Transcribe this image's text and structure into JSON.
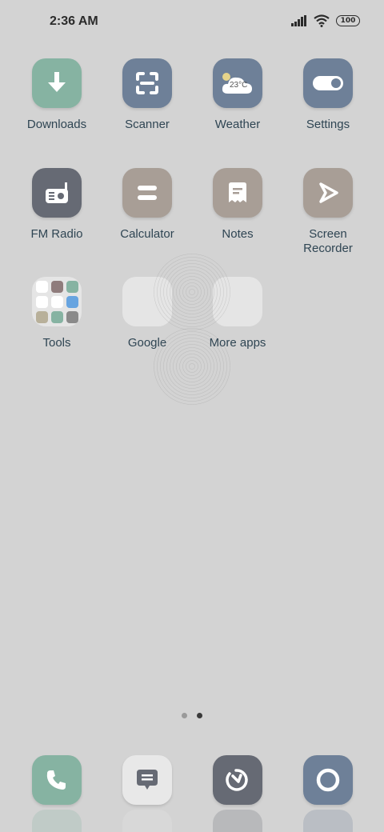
{
  "status_bar": {
    "time": "2:36 AM",
    "battery": "100",
    "icons": [
      "signal-icon",
      "wifi-icon",
      "battery-icon"
    ]
  },
  "apps": [
    {
      "label": "Downloads",
      "icon": "download-icon",
      "color": "#86b3a2"
    },
    {
      "label": "Scanner",
      "icon": "scanner-icon",
      "color": "#6e8098"
    },
    {
      "label": "Weather",
      "icon": "weather-icon",
      "color": "#6e8098",
      "icon_text": "23°C"
    },
    {
      "label": "Settings",
      "icon": "toggle-icon",
      "color": "#6e8098"
    },
    {
      "label": "FM Radio",
      "icon": "radio-icon",
      "color": "#666a74"
    },
    {
      "label": "Calculator",
      "icon": "calculator-icon",
      "color": "#a89e96"
    },
    {
      "label": "Notes",
      "icon": "notes-icon",
      "color": "#a89e96"
    },
    {
      "label": "Screen Recorder",
      "icon": "screen-recorder-icon",
      "color": "#a89e96"
    }
  ],
  "folders": [
    {
      "label": "Tools",
      "mini_icons": [
        "#6e8098",
        "#cfcfcf",
        "#6e8098",
        "#7aa6d6",
        "#f0c066",
        "#6e8098",
        "#f2e14a",
        "#6e8098",
        "#ffffff"
      ]
    },
    {
      "label": "Google",
      "mini_icons": [
        "#ffffff",
        "#8f7c7c",
        "#86b3a2",
        "#ffffff",
        "#ffffff",
        "#67a4e0",
        "#b8b09a",
        "#86b3a2",
        "#8a8a8a"
      ]
    },
    {
      "label": "More apps",
      "mini_icons": [
        "#6e8098",
        "#6e8098",
        "#8f7c7c",
        "#ffffff",
        "#d9a07c"
      ]
    }
  ],
  "page_indicator": {
    "total": 2,
    "active": 2,
    "active_color": "#3a3a3a",
    "inactive_color": "#9a9a9a"
  },
  "dock": [
    {
      "name": "phone",
      "icon": "phone-icon",
      "color": "#86b3a2"
    },
    {
      "name": "messages",
      "icon": "message-icon",
      "color": "#e8e8e8"
    },
    {
      "name": "clock",
      "icon": "history-icon",
      "color": "#666a74"
    },
    {
      "name": "camera",
      "icon": "camera-icon",
      "color": "#6e8098"
    }
  ]
}
